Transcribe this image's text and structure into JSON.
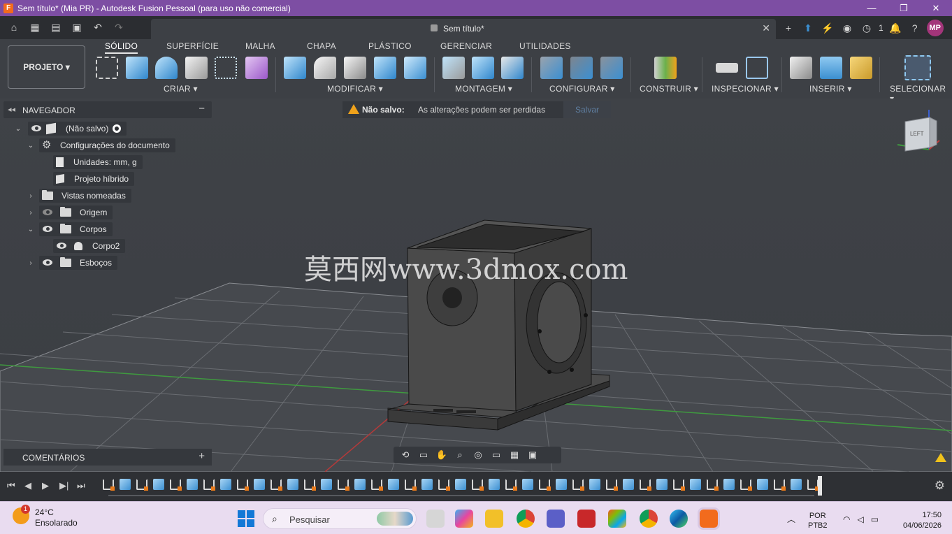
{
  "titlebar": {
    "app_icon": "F",
    "title": "Sem título* (Mia PR) - Autodesk Fusion Pessoal (para uso não comercial)",
    "minimize": "—",
    "restore": "❐",
    "close": "✕"
  },
  "tabstrip": {
    "doc_title": "Sem título*",
    "close_tab": "✕",
    "notifications_count": "1",
    "avatar": "MP"
  },
  "toolbar": {
    "project_button": "PROJETO ▾",
    "tabs": [
      "SÓLIDO",
      "SUPERFÍCIE",
      "MALHA",
      "CHAPA",
      "PLÁSTICO",
      "GERENCIAR",
      "UTILIDADES"
    ],
    "groups": [
      "CRIAR ▾",
      "MODIFICAR ▾",
      "MONTAGEM ▾",
      "CONFIGURAR ▾",
      "CONSTRUIR ▾",
      "INSPECIONAR ▾",
      "INSERIR ▾",
      "SELECIONAR ▾"
    ]
  },
  "navigator": {
    "title": "NAVEGADOR",
    "collapse": "−",
    "items": [
      {
        "label": "(Não salvo)"
      },
      {
        "label": "Configurações do documento"
      },
      {
        "label": "Unidades: mm, g"
      },
      {
        "label": "Projeto híbrido"
      },
      {
        "label": "Vistas nomeadas"
      },
      {
        "label": "Origem"
      },
      {
        "label": "Corpos"
      },
      {
        "label": "Corpo2"
      },
      {
        "label": "Esboços"
      }
    ]
  },
  "warning": {
    "title": "Não salvo:",
    "message": "As alterações podem ser perdidas",
    "save_button": "Salvar"
  },
  "viewcube": {
    "face": "LEFT"
  },
  "watermark": "莫西网www.3dmox.com",
  "comments": {
    "title": "COMENTÁRIOS",
    "add": "+"
  },
  "taskbar": {
    "temperature": "24°C",
    "weather": "Ensolarado",
    "weather_badge": "1",
    "search_placeholder": "Pesquisar",
    "language_top": "POR",
    "language_bottom": "PTB2",
    "time": "17:50",
    "date": "04/06/2026"
  },
  "colors": {
    "titlebar": "#7d4ea3",
    "toolbar": "#3d4045",
    "viewport": "#3f4247",
    "warning": "#f0a21b",
    "accent_blue": "#3b8fd1",
    "sketch_orange": "#e97b1c"
  }
}
